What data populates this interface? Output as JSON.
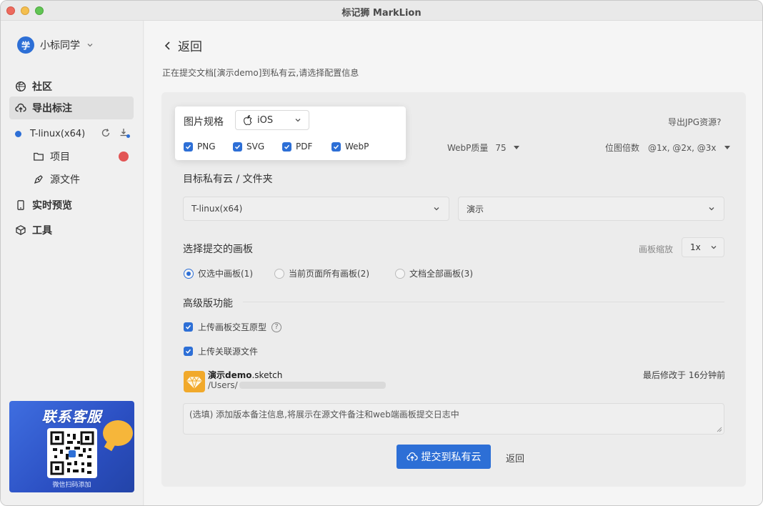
{
  "window": {
    "title": "标记狮 MarkLion"
  },
  "user": {
    "avatar_text": "学",
    "name": "小标同学"
  },
  "nav": {
    "community": "社区",
    "export": "导出标注",
    "project_name": "T-linux(x64)",
    "sub_project": "项目",
    "sub_source": "源文件",
    "preview": "实时预览",
    "tools": "工具"
  },
  "promo": {
    "title": "联系客服",
    "caption": "微信扫码添加"
  },
  "header": {
    "back_label": "返回",
    "description": "正在提交文档[演示demo]到私有云,请选择配置信息"
  },
  "spec": {
    "label": "图片规格",
    "platform": "iOS",
    "formats": [
      "PNG",
      "SVG",
      "PDF",
      "WebP"
    ],
    "jpg_link": "导出JPG资源?",
    "webp_quality_label": "WebP质量",
    "webp_quality_value": "75",
    "bitmap_label": "位图倍数",
    "bitmap_value": "@1x, @2x, @3x"
  },
  "target": {
    "title": "目标私有云 / 文件夹",
    "cloud_value": "T-linux(x64)",
    "folder_value": "演示"
  },
  "artboards": {
    "title": "选择提交的画板",
    "zoom_label": "画板缩放",
    "zoom_value": "1x",
    "options": [
      "仅选中画板(1)",
      "当前页面所有画板(2)",
      "文档全部画板(3)"
    ],
    "selected": "仅选中画板(1)"
  },
  "advanced": {
    "title": "高级版功能",
    "upload_prototype": "上传画板交互原型",
    "upload_linked": "上传关联源文件"
  },
  "file": {
    "name_bold": "演示demo",
    "name_ext": ".sketch",
    "path": "/Users/",
    "modified": "最后修改于 16分钟前"
  },
  "note": {
    "placeholder": "(选填) 添加版本备注信息,将展示在源文件备注和web端画板提交日志中"
  },
  "actions": {
    "submit": "提交到私有云",
    "back": "返回"
  },
  "colors": {
    "accent": "#2d6fd6",
    "promo_bg": "#3a63d6",
    "sketch_icon": "#f1a92b"
  }
}
